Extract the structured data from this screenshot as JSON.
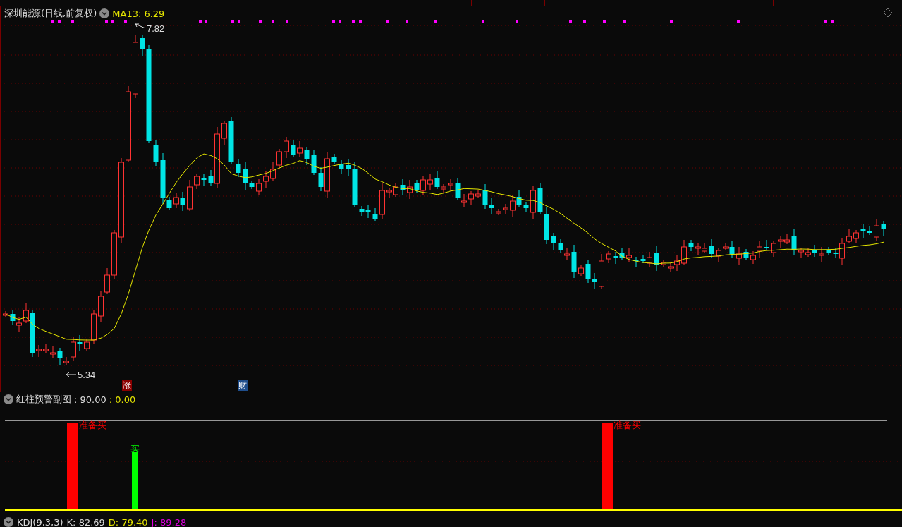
{
  "main_chart": {
    "title": "深圳能源(日线,前复权)",
    "indicator": "MA13: 6.29",
    "high_label": "7.82",
    "low_label": "5.34",
    "badges": [
      {
        "text": "涨",
        "kind": "rise"
      },
      {
        "text": "财",
        "kind": "finance"
      }
    ]
  },
  "sub_chart": {
    "title": "红柱预警副图",
    "value_1": ": 90.00",
    "value_2": ": 0.00",
    "signals": [
      {
        "kind": "buy",
        "label": "准备买"
      },
      {
        "kind": "sell",
        "label": "卖"
      },
      {
        "kind": "buy",
        "label": "准备买"
      }
    ]
  },
  "kdj": {
    "title": "KDJ(9,3,3)",
    "k": "K: 82.69",
    "d": "D: 79.40",
    "j": "J: 89.28"
  }
}
